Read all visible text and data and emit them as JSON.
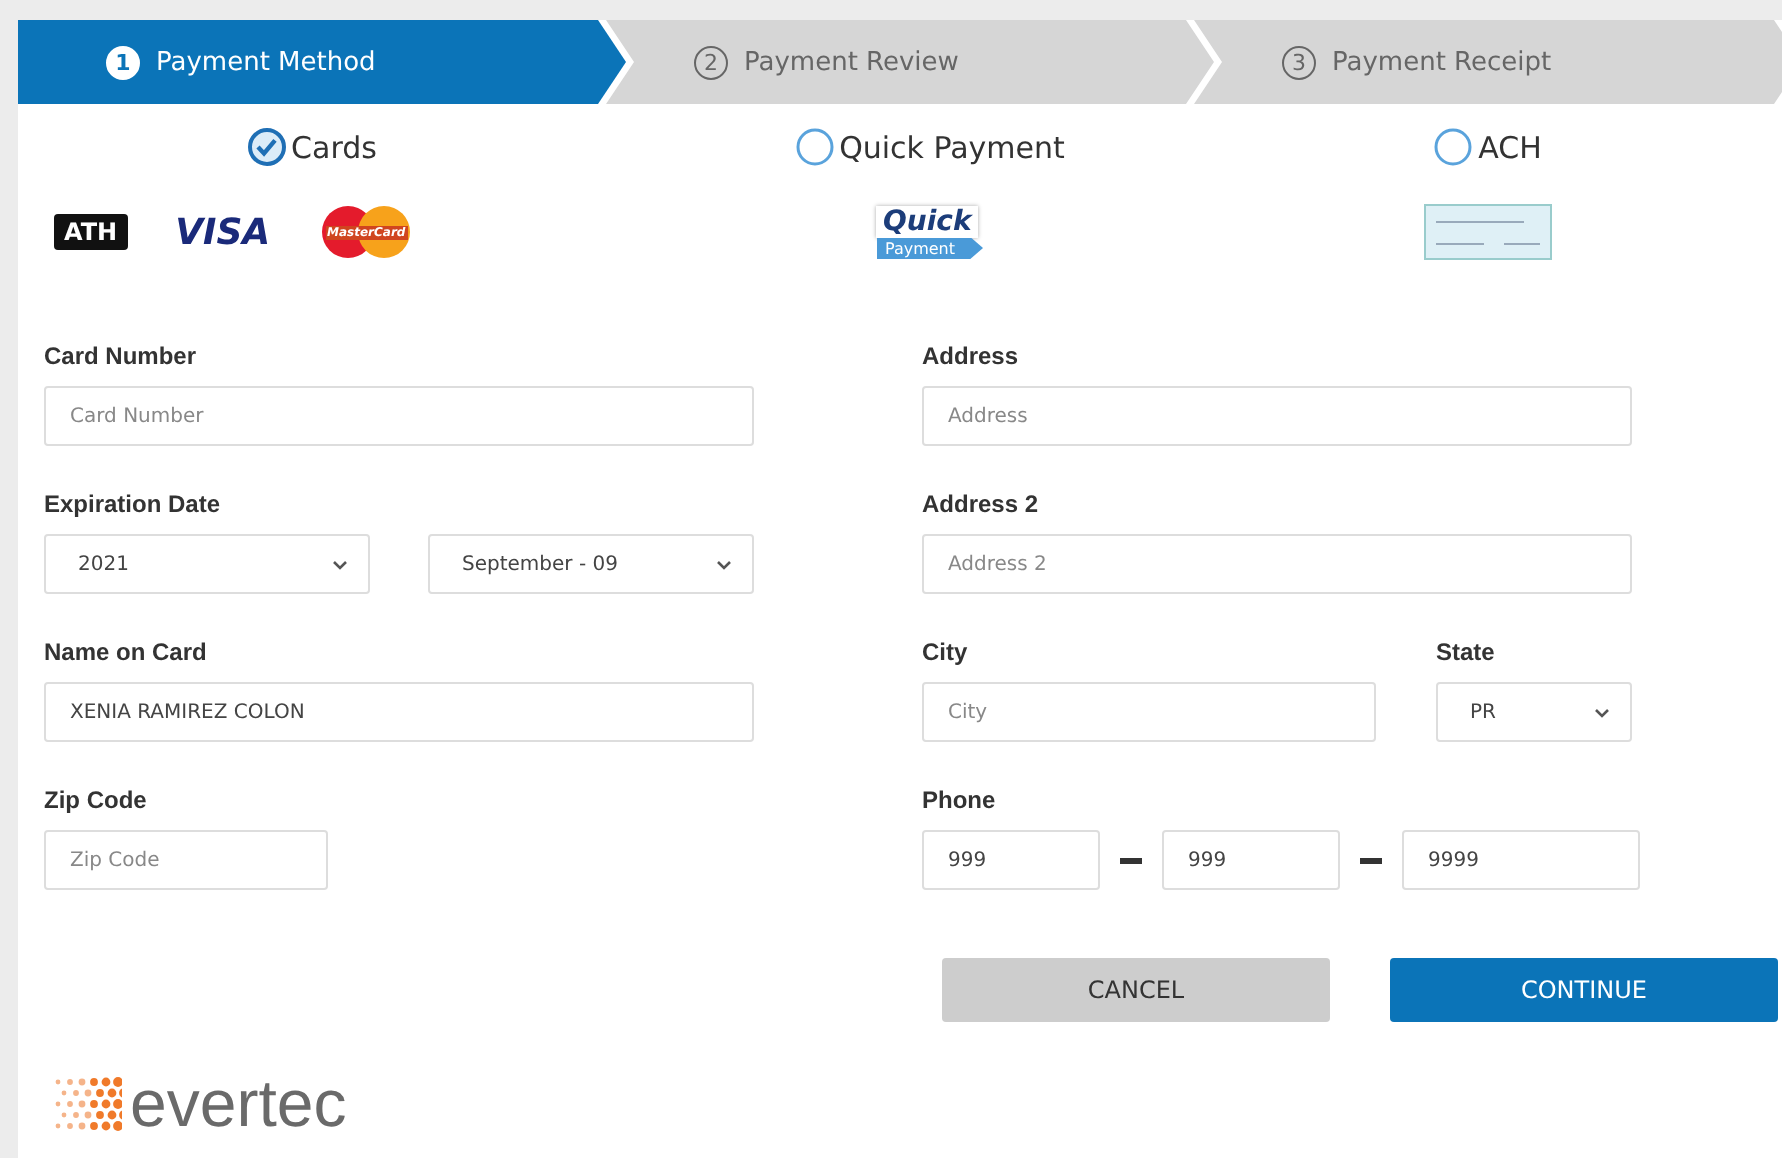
{
  "steps": [
    {
      "number": "1",
      "label": "Payment Method",
      "selected": true
    },
    {
      "number": "2",
      "label": "Payment Review",
      "selected": false
    },
    {
      "number": "3",
      "label": "Payment Receipt",
      "selected": false
    }
  ],
  "payment_methods": [
    {
      "label": "Cards",
      "selected": true,
      "logos": [
        {
          "kind": "ath",
          "text": "ATH"
        },
        {
          "kind": "visa",
          "text": "VISA"
        },
        {
          "kind": "mastercard",
          "text": "MasterCard"
        }
      ]
    },
    {
      "label": "Quick Payment",
      "selected": false,
      "logos": [
        {
          "kind": "quick",
          "text": "Quick",
          "subtext": "Payment"
        }
      ]
    },
    {
      "label": "ACH",
      "selected": false,
      "logos": [
        {
          "kind": "check"
        }
      ]
    }
  ],
  "form": {
    "left": [
      [
        {
          "label": "Card Number",
          "kind": "text",
          "controls": [
            {
              "placeholder": "Card Number"
            }
          ]
        }
      ],
      [
        {
          "label": "Expiration Date",
          "kind": "select_pair",
          "controls": [
            {
              "value": "2021"
            },
            {
              "value": "September - 09"
            }
          ]
        }
      ],
      [
        {
          "label": "Name on Card",
          "kind": "text",
          "controls": [
            {
              "value": "XENIA RAMIREZ COLON"
            }
          ]
        }
      ],
      [
        {
          "label": "Zip Code",
          "kind": "short",
          "controls": [
            {
              "placeholder": "Zip Code"
            }
          ]
        }
      ]
    ],
    "right": [
      [
        {
          "label": "Address",
          "kind": "text",
          "controls": [
            {
              "placeholder": "Address"
            }
          ]
        }
      ],
      [
        {
          "label": "Address 2",
          "kind": "text",
          "controls": [
            {
              "placeholder": "Address 2"
            }
          ]
        }
      ],
      [
        {
          "label": "City",
          "kind": "text",
          "controls": [
            {
              "placeholder": "City"
            }
          ]
        },
        {
          "label": "State",
          "kind": "select",
          "controls": [
            {
              "value": "PR"
            }
          ]
        }
      ],
      [
        {
          "label": "Phone",
          "kind": "phone",
          "controls": [
            {
              "value": "999"
            },
            {
              "value": "999"
            },
            {
              "value": "9999"
            }
          ]
        }
      ]
    ]
  },
  "buttons": [
    {
      "label": "CANCEL",
      "kind": "secondary"
    },
    {
      "label": "CONTINUE",
      "kind": "primary"
    }
  ],
  "footer": {
    "brand": "evertec"
  }
}
